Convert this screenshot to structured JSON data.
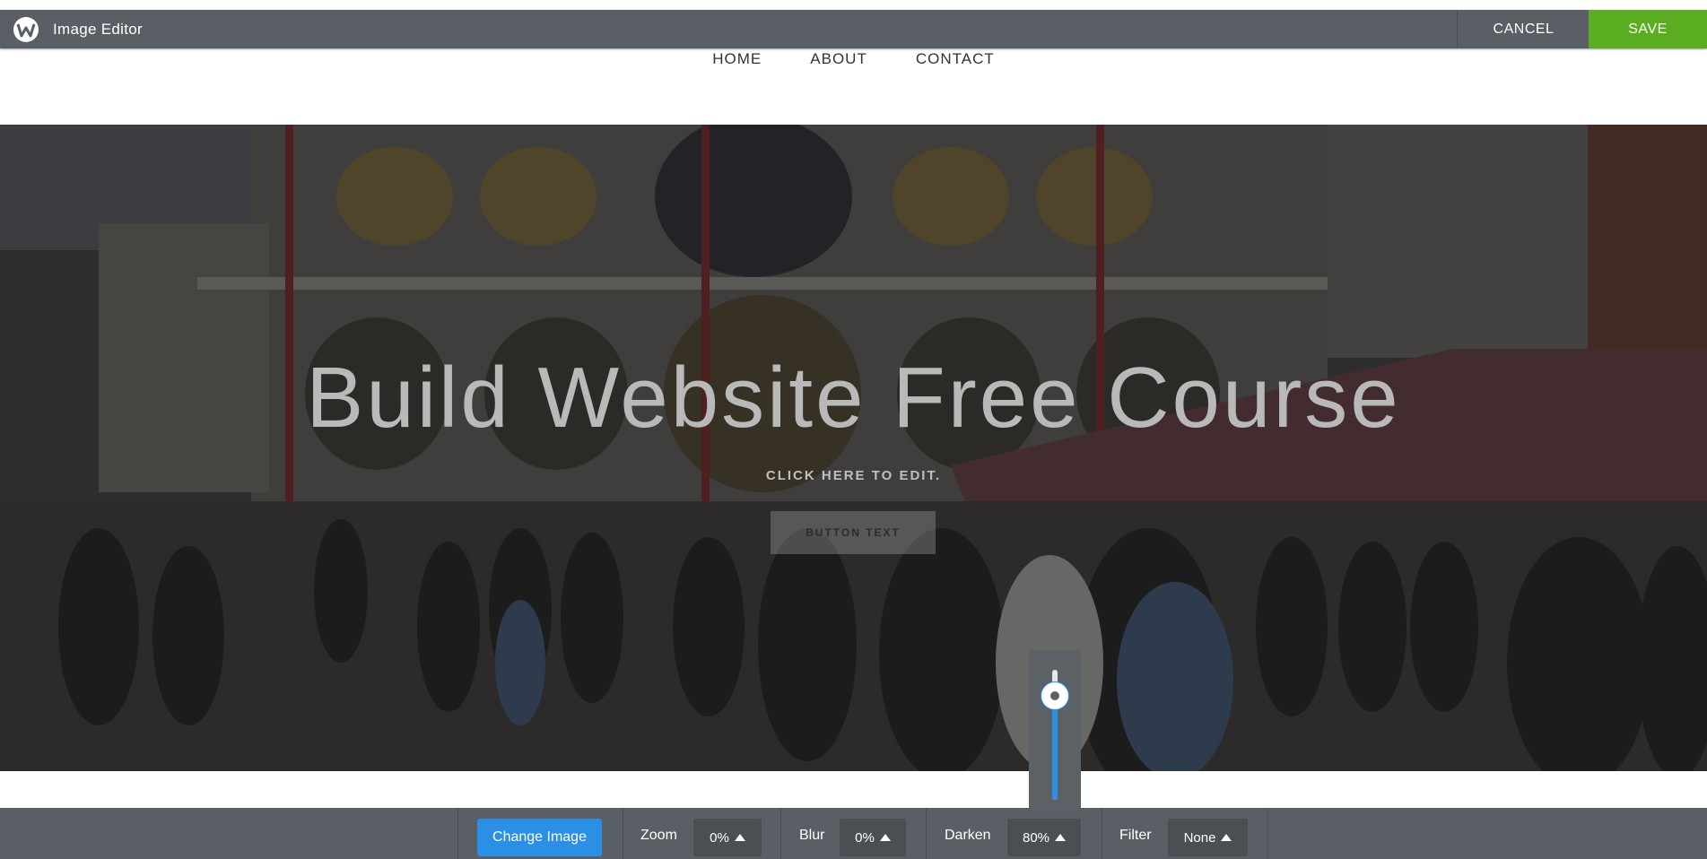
{
  "topbar": {
    "title": "Image Editor",
    "cancel_label": "CANCEL",
    "save_label": "SAVE",
    "logo_icon": "weebly-w-icon",
    "save_color": "#5aad20"
  },
  "nav": {
    "items": [
      "HOME",
      "ABOUT",
      "CONTACT"
    ]
  },
  "hero": {
    "title": "Build Website Free Course",
    "subtitle": "CLICK HERE TO EDIT.",
    "button_label": "BUTTON TEXT"
  },
  "darken_slider": {
    "level_percent": 80,
    "accent": "#2b8fe6"
  },
  "toolbar": {
    "change_image_label": "Change Image",
    "zoom": {
      "label": "Zoom",
      "value": "0%"
    },
    "blur": {
      "label": "Blur",
      "value": "0%"
    },
    "darken": {
      "label": "Darken",
      "value": "80%"
    },
    "filter": {
      "label": "Filter",
      "value": "None"
    },
    "accent": "#2b8fe6"
  }
}
